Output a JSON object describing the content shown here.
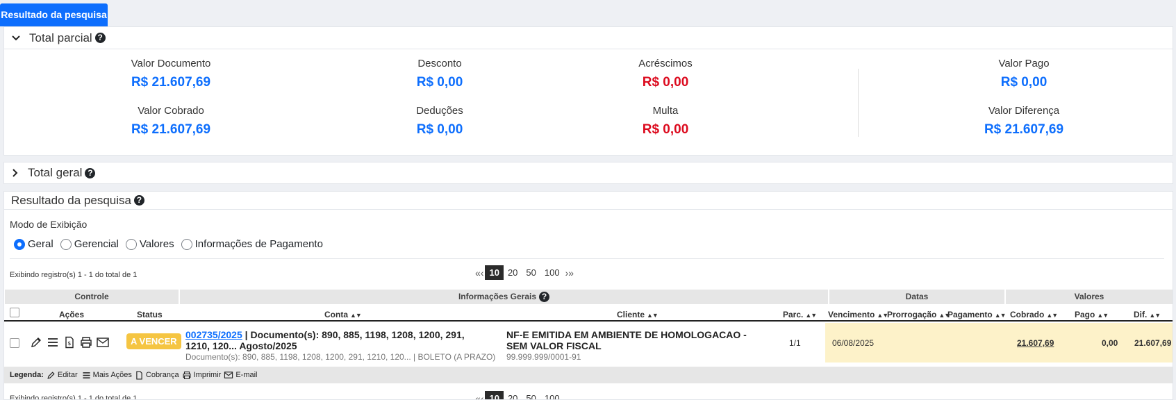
{
  "tab": {
    "label": "Resultado da pesquisa"
  },
  "total_parcial": {
    "title": "Total parcial",
    "metrics": {
      "valor_documento": {
        "label": "Valor Documento",
        "value": "R$ 21.607,69"
      },
      "desconto": {
        "label": "Desconto",
        "value": "R$ 0,00"
      },
      "acrescimos": {
        "label": "Acréscimos",
        "value": "R$ 0,00"
      },
      "valor_pago": {
        "label": "Valor Pago",
        "value": "R$ 0,00"
      },
      "valor_cobrado": {
        "label": "Valor Cobrado",
        "value": "R$ 21.607,69"
      },
      "deducoes": {
        "label": "Deduções",
        "value": "R$ 0,00"
      },
      "multa": {
        "label": "Multa",
        "value": "R$ 0,00"
      },
      "valor_diferenca": {
        "label": "Valor Diferença",
        "value": "R$ 21.607,69"
      }
    }
  },
  "total_geral": {
    "title": "Total geral"
  },
  "resultado": {
    "title": "Resultado da pesquisa",
    "modo_label": "Modo de Exibição",
    "modes": [
      "Geral",
      "Gerencial",
      "Valores",
      "Informações de Pagamento"
    ],
    "selected_mode": "Geral",
    "records_text": "Exibindo registro(s) 1 - 1 do total de 1",
    "page_sizes": [
      "10",
      "20",
      "50",
      "100"
    ],
    "selected_page_size": "10",
    "groups": {
      "controle": "Controle",
      "informacoes": "Informações Gerais",
      "datas": "Datas",
      "valores": "Valores"
    },
    "columns": {
      "acoes": "Ações",
      "status": "Status",
      "conta": "Conta",
      "cliente": "Cliente",
      "parc": "Parc.",
      "vencimento": "Vencimento",
      "prorrogacao": "Prorrogação",
      "pagamento": "Pagamento",
      "cobrado": "Cobrado",
      "pago": "Pago",
      "dif": "Dif."
    },
    "row": {
      "status": "A VENCER",
      "conta_link": "002735/2025",
      "conta_text": " | Documento(s): 890, 885, 1198, 1208, 1200, 291, 1210, 120... Agosto/2025",
      "conta_sub": "Documento(s): 890, 885, 1198, 1208, 1200, 291, 1210, 120... | BOLETO (A PRAZO)",
      "cliente": "NF-E EMITIDA EM AMBIENTE DE HOMOLOGACAO - SEM VALOR FISCAL",
      "cliente_sub": "99.999.999/0001-91",
      "parc": "1/1",
      "vencimento": "06/08/2025",
      "cobrado": "21.607,69",
      "pago": "0,00",
      "dif": "21.607,69"
    },
    "legend": {
      "label": "Legenda:",
      "editar": "Editar",
      "mais_acoes": "Mais Ações",
      "cobranca": "Cobrança",
      "imprimir": "Imprimir",
      "email": "E-mail"
    }
  }
}
